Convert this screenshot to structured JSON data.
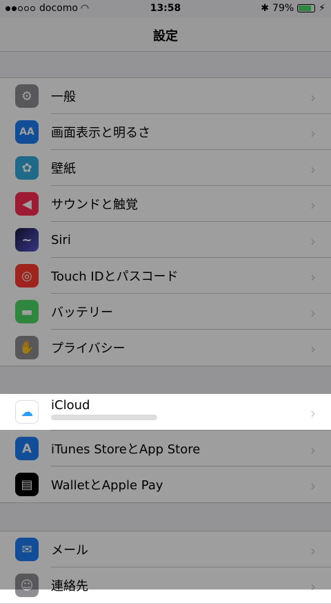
{
  "status": {
    "carrier": "docomo",
    "time": "13:58",
    "battery": "79%"
  },
  "nav": {
    "title": "設定"
  },
  "groups": [
    {
      "items": [
        {
          "label": "一般",
          "icon": "gear-icon",
          "color": "#8e8e93"
        },
        {
          "label": "画面表示と明るさ",
          "icon": "text-size-icon",
          "color": "#1e7cf6"
        },
        {
          "label": "壁紙",
          "icon": "wallpaper-icon",
          "color": "#34aadc"
        },
        {
          "label": "サウンドと触覚",
          "icon": "speaker-icon",
          "color": "#ff2d55"
        },
        {
          "label": "Siri",
          "icon": "siri-icon",
          "color": "#5856d6"
        },
        {
          "label": "Touch IDとパスコード",
          "icon": "fingerprint-icon",
          "color": "#ff3b30"
        },
        {
          "label": "バッテリー",
          "icon": "battery-icon",
          "color": "#4cd964"
        },
        {
          "label": "プライバシー",
          "icon": "hand-icon",
          "color": "#8e8e93"
        }
      ]
    },
    {
      "items": [
        {
          "label": "iCloud",
          "icon": "cloud-icon",
          "color": "#ffffff"
        },
        {
          "label": "iTunes StoreとApp Store",
          "icon": "app-store-icon",
          "color": "#1e7cf6"
        },
        {
          "label": "WalletとApple Pay",
          "icon": "wallet-icon",
          "color": "#000000"
        }
      ]
    },
    {
      "items": [
        {
          "label": "メール",
          "icon": "mail-icon",
          "color": "#1e7cf6"
        },
        {
          "label": "連絡先",
          "icon": "contacts-icon",
          "color": "#8e8e93"
        }
      ]
    }
  ]
}
